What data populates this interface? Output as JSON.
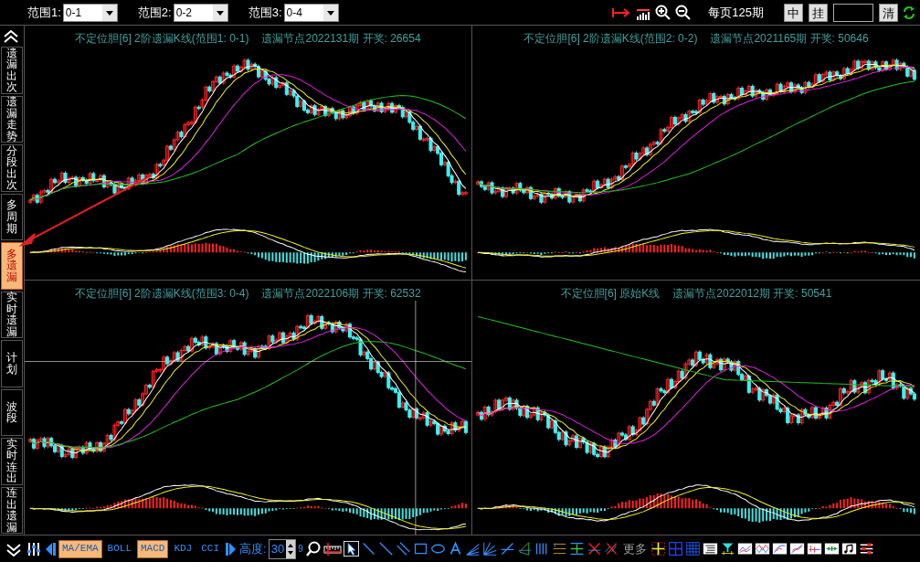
{
  "top_bar": {
    "ranges": [
      {
        "label": "范围1:",
        "value": "0-1"
      },
      {
        "label": "范围2:",
        "value": "0-2"
      },
      {
        "label": "范围3:",
        "value": "0-4"
      }
    ],
    "per_page": "每页125期",
    "right_controls": [
      {
        "kind": "button",
        "label": "中"
      },
      {
        "kind": "button",
        "label": "挂"
      },
      {
        "kind": "field"
      },
      {
        "kind": "button",
        "label": "清"
      }
    ]
  },
  "sidebar": {
    "items": [
      {
        "label": "遗漏出次",
        "selected": false
      },
      {
        "label": "遗漏走势",
        "selected": false
      },
      {
        "label": "分段出次",
        "selected": false
      },
      {
        "label": "多周期",
        "selected": false
      },
      {
        "label": "多遗漏",
        "selected": true
      },
      {
        "label": "实时遗漏",
        "selected": false
      },
      {
        "label": "计划",
        "selected": false
      },
      {
        "label": "波段",
        "selected": false
      },
      {
        "label": "实时连出",
        "selected": false
      },
      {
        "label": "连出遗漏",
        "selected": false
      }
    ]
  },
  "panels": [
    {
      "title": "不定位胆[6] 2阶遗漏K线(范围1: 0-1)",
      "node": "遗漏节点2022131期 开奖: 26654",
      "crosshair": false
    },
    {
      "title": "不定位胆[6] 2阶遗漏K线(范围2: 0-2)",
      "node": "遗漏节点2021165期 开奖: 50646",
      "crosshair": false
    },
    {
      "title": "不定位胆[6] 2阶遗漏K线(范围3: 0-4)",
      "node": "遗漏节点2022106期 开奖: 62532",
      "crosshair": true
    },
    {
      "title": "不定位胆[6] 原始K线",
      "node": "遗漏节点2022012期 开奖: 50541",
      "crosshair": false
    }
  ],
  "bottom_bar": {
    "indicators": [
      {
        "label": "MA/EMA",
        "selected": true
      },
      {
        "label": "BOLL",
        "selected": false
      },
      {
        "label": "MACD",
        "selected": true
      },
      {
        "label": "KDJ",
        "selected": false
      },
      {
        "label": "CCI",
        "selected": false
      }
    ],
    "height": {
      "label": "高度:",
      "value": "30"
    },
    "digit": "9",
    "more": "更多"
  }
}
